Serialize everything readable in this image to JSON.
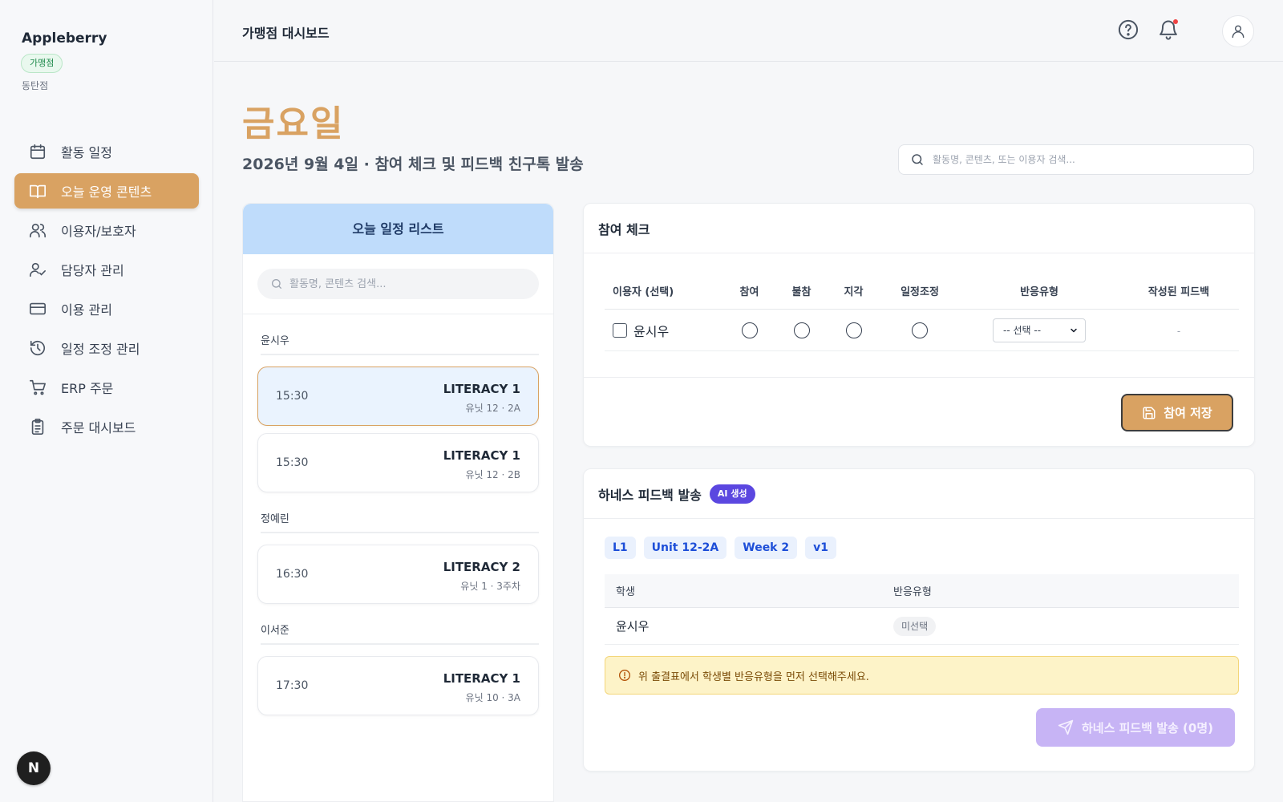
{
  "sidebar": {
    "brand": "Appleberry",
    "badge": "가맹점",
    "branch": "동탄점",
    "items": [
      {
        "label": "활동 일정",
        "icon": "calendar-icon"
      },
      {
        "label": "오늘 운영 콘텐츠",
        "icon": "book-open-icon",
        "active": true
      },
      {
        "label": "이용자/보호자",
        "icon": "users-icon"
      },
      {
        "label": "담당자 관리",
        "icon": "user-check-icon"
      },
      {
        "label": "이용 관리",
        "icon": "credit-card-icon"
      },
      {
        "label": "일정 조정 관리",
        "icon": "history-icon"
      },
      {
        "label": "ERP 주문",
        "icon": "cart-icon"
      },
      {
        "label": "주문 대시보드",
        "icon": "clipboard-icon"
      }
    ],
    "footer_badge": "N"
  },
  "header": {
    "title": "가맹점 대시보드"
  },
  "page": {
    "day": "금요일",
    "subtitle": "2026년 9월 4일 · 참여 체크 및 피드백 친구톡 발송",
    "search_placeholder": "활동명, 콘텐츠, 또는 이용자 검색..."
  },
  "schedule": {
    "title": "오늘 일정 리스트",
    "search_placeholder": "활동명, 콘텐츠 검색...",
    "groups": [
      {
        "name": "윤시우",
        "items": [
          {
            "time": "15:30",
            "course": "LITERACY 1",
            "unit": "유닛 12 · 2A",
            "selected": true
          },
          {
            "time": "15:30",
            "course": "LITERACY 1",
            "unit": "유닛 12 · 2B"
          }
        ]
      },
      {
        "name": "정예린",
        "items": [
          {
            "time": "16:30",
            "course": "LITERACY 2",
            "unit": "유닛 1 · 3주차"
          }
        ]
      },
      {
        "name": "이서준",
        "items": [
          {
            "time": "17:30",
            "course": "LITERACY 1",
            "unit": "유닛 10 · 3A"
          }
        ]
      }
    ]
  },
  "attendance": {
    "title": "참여 체크",
    "columns": [
      "이용자 (선택)",
      "참여",
      "불참",
      "지각",
      "일정조정",
      "반응유형",
      "작성된 피드백"
    ],
    "rows": [
      {
        "name": "윤시우",
        "type_select": "-- 선택 --",
        "feedback": "-"
      }
    ],
    "save_label": "참여 저장"
  },
  "feedback": {
    "title": "하네스 피드백 발송",
    "ai_badge": "AI 생성",
    "chips": [
      "L1",
      "Unit 12-2A",
      "Week 2",
      "v1"
    ],
    "columns": [
      "학생",
      "반응유형"
    ],
    "rows": [
      {
        "student": "윤시우",
        "type": "미선택"
      }
    ],
    "warning": "위 출결표에서 학생별 반응유형을 먼저 선택해주세요.",
    "send_label": "하네스 피드백 발송 (0명)"
  },
  "colors": {
    "accent": "#d9a262",
    "schedule_header": "#bfdcfb",
    "ai_badge": "#5b47e0",
    "send_disabled": "#c7b4f5",
    "warning_bg": "#fdf3c8"
  }
}
